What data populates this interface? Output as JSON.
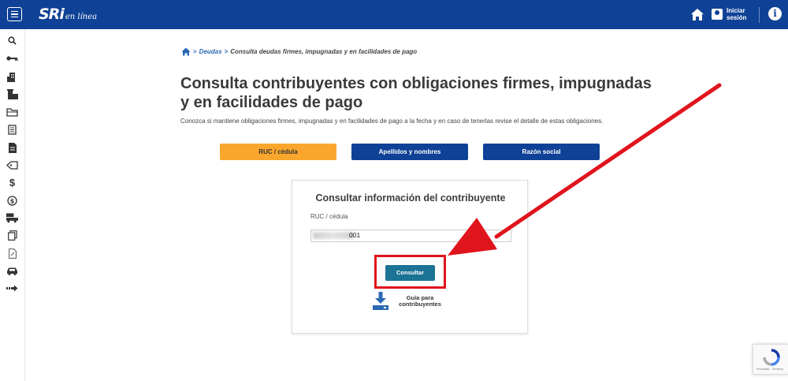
{
  "header": {
    "logo_main": "SRi",
    "logo_sub": "en línea",
    "login_label": "Iniciar sesión",
    "brand_color": "#0f4296",
    "icons": [
      "menu-icon",
      "home-icon",
      "user-icon",
      "info-icon"
    ]
  },
  "sidebar": {
    "icons": [
      "search-icon",
      "key-icon",
      "building-icon",
      "office-icon",
      "folder-icon",
      "document-icon",
      "file-icon",
      "tag-icon",
      "dollar-icon",
      "coin-icon",
      "truck-icon",
      "copy-icon",
      "edit-document-icon",
      "car-icon",
      "arrow-right-icon"
    ]
  },
  "breadcrumb": {
    "link": "Deudas",
    "separator": ">",
    "current": "Consulta deudas firmes, impugnadas y en facilidades de pago"
  },
  "page": {
    "title": "Consulta contribuyentes con obligaciones firmes, impugnadas y en facilidades de pago",
    "description": "Conozca si mantiene obligaciones firmes, impugnadas y en facilidades de pago a la fecha y en caso de tenerlas revise el detalle de estas obligaciones."
  },
  "tabs": [
    {
      "label": "RUC / cédula",
      "color": "#f9a62d",
      "active": true
    },
    {
      "label": "Apellidos y nombres",
      "color": "#0f4296",
      "active": false
    },
    {
      "label": "Razón social",
      "color": "#0f4296",
      "active": false
    }
  ],
  "form": {
    "title": "Consultar información del contribuyente",
    "field_label": "RUC / cédula",
    "field_value_visible": "001",
    "submit_label": "Consultar",
    "submit_color": "#1b7396",
    "guide_label": "Guía para contribuyentes"
  },
  "annotation": {
    "color": "#e0141c"
  },
  "recaptcha": {
    "text": "Privacidad - Términos"
  }
}
